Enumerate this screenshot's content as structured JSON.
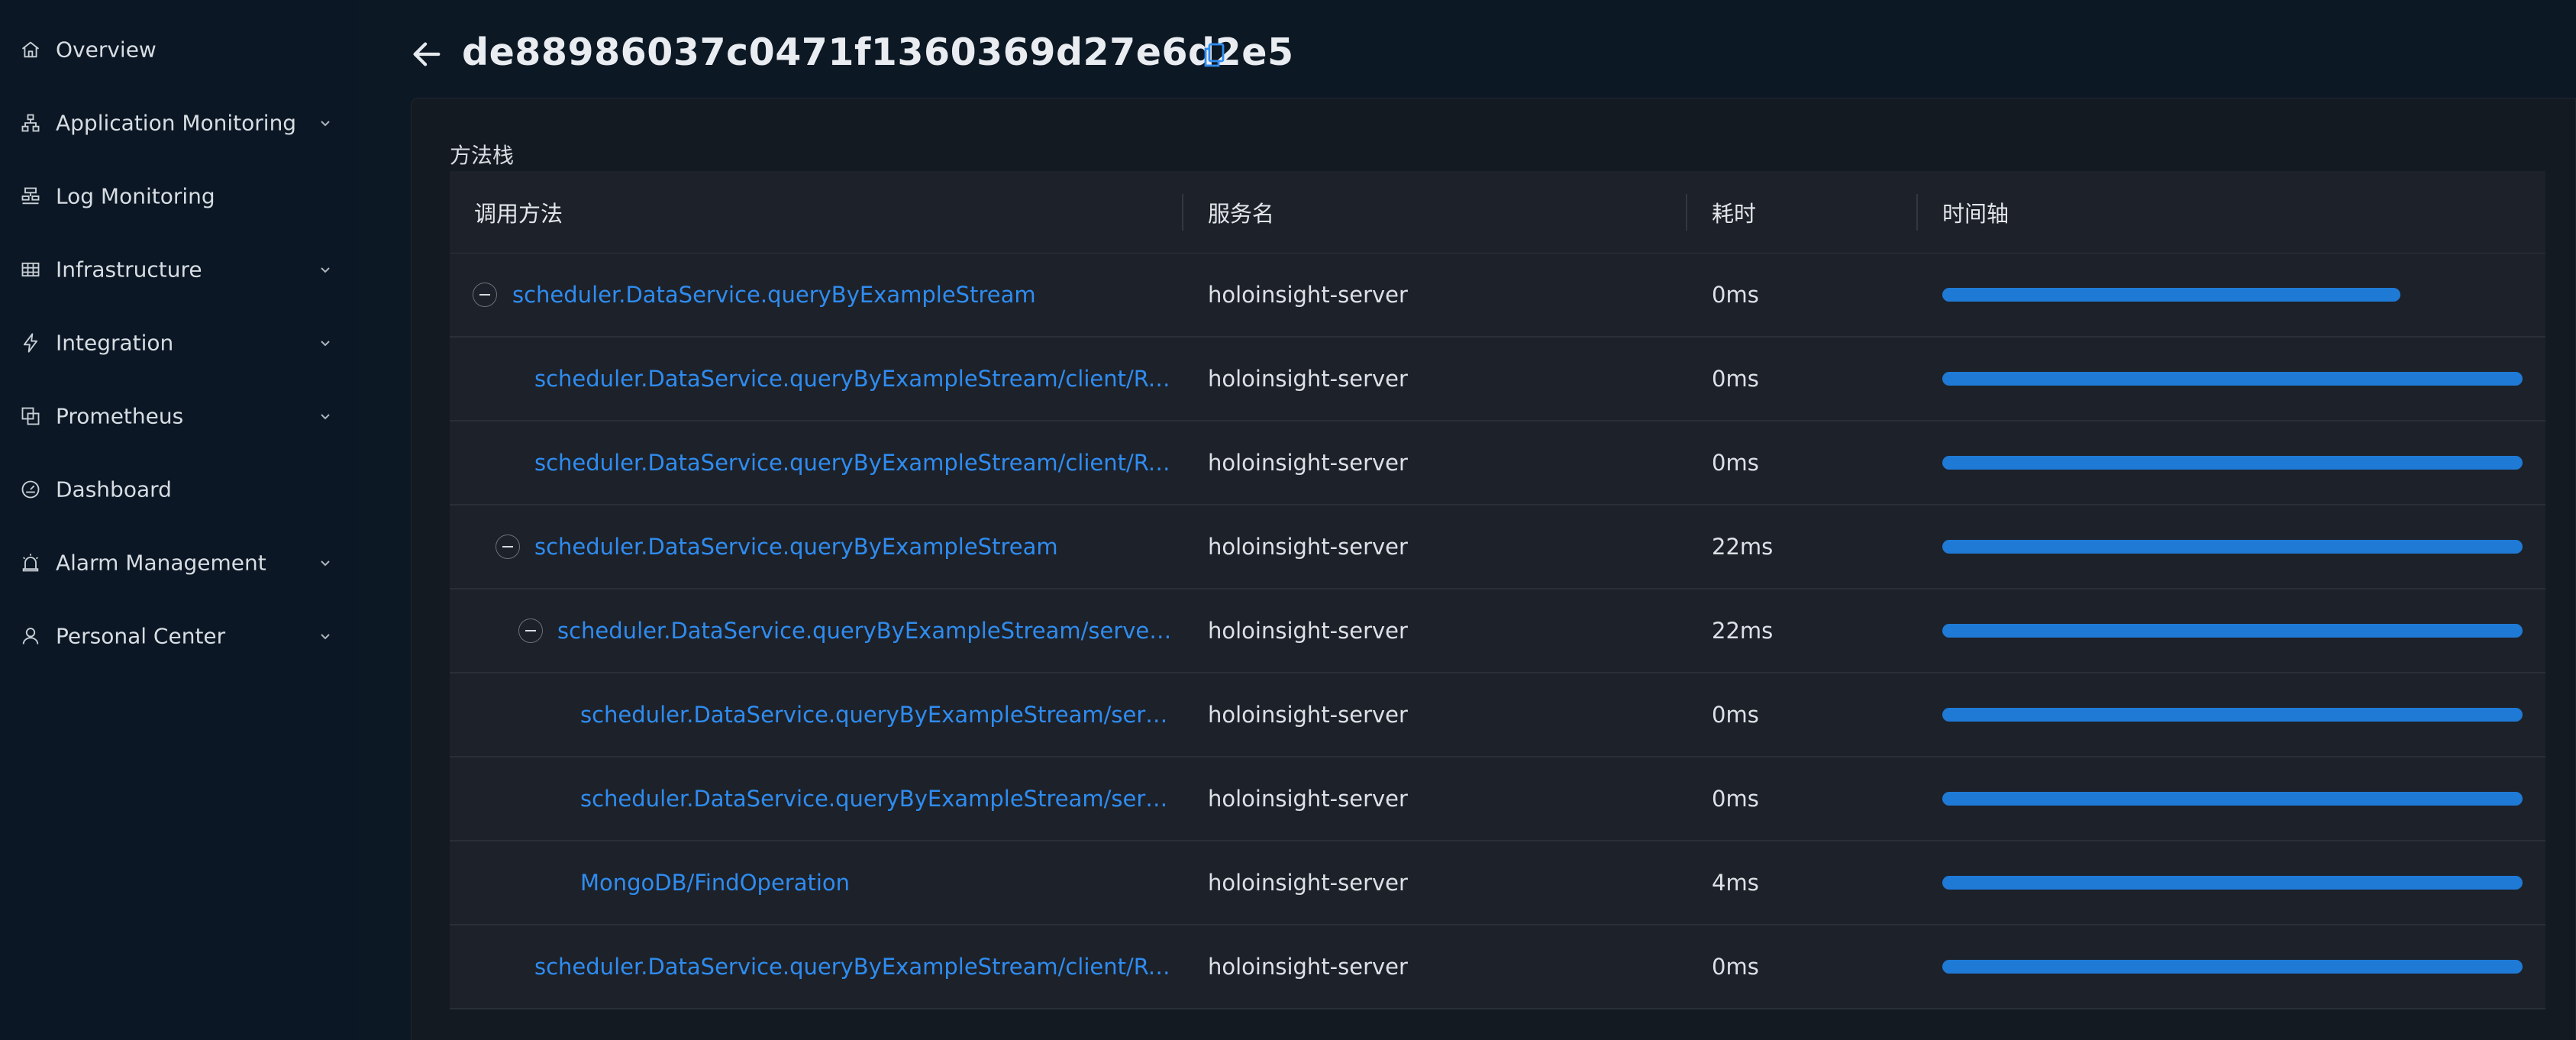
{
  "sidebar": {
    "items": [
      {
        "label": "Overview",
        "icon": "home-icon",
        "expandable": false
      },
      {
        "label": "Application Monitoring",
        "icon": "hierarchy-icon",
        "expandable": true
      },
      {
        "label": "Log Monitoring",
        "icon": "log-tree-icon",
        "expandable": false
      },
      {
        "label": "Infrastructure",
        "icon": "table-grid-icon",
        "expandable": true
      },
      {
        "label": "Integration",
        "icon": "lightning-icon",
        "expandable": true
      },
      {
        "label": "Prometheus",
        "icon": "overlap-squares-icon",
        "expandable": true
      },
      {
        "label": "Dashboard",
        "icon": "gauge-icon",
        "expandable": false
      },
      {
        "label": "Alarm Management",
        "icon": "alarm-icon",
        "expandable": true
      },
      {
        "label": "Personal Center",
        "icon": "user-icon",
        "expandable": true
      }
    ]
  },
  "header": {
    "trace_id": "de88986037c0471f1360369d27e6d2e5",
    "back_icon": "arrow-left-icon",
    "copy_icon": "copy-icon"
  },
  "panel": {
    "section_label": "方法栈",
    "columns": [
      "调用方法",
      "服务名",
      "耗时",
      "时间轴"
    ],
    "rows": [
      {
        "method": "scheduler.DataService.queryByExampleStream",
        "service": "holoinsight-server",
        "duration": "0ms",
        "depth": 0,
        "expandable": true,
        "timeline_fraction": 0.79
      },
      {
        "method": "scheduler.DataService.queryByExampleStream/client/Reques...",
        "service": "holoinsight-server",
        "duration": "0ms",
        "depth": 1,
        "expandable": false,
        "timeline_fraction": 1.0
      },
      {
        "method": "scheduler.DataService.queryByExampleStream/client/Respon...",
        "service": "holoinsight-server",
        "duration": "0ms",
        "depth": 1,
        "expandable": false,
        "timeline_fraction": 1.0
      },
      {
        "method": "scheduler.DataService.queryByExampleStream",
        "service": "holoinsight-server",
        "duration": "22ms",
        "depth": 1,
        "expandable": true,
        "timeline_fraction": 1.0
      },
      {
        "method": "scheduler.DataService.queryByExampleStream/server/Req...",
        "service": "holoinsight-server",
        "duration": "22ms",
        "depth": 2,
        "expandable": true,
        "timeline_fraction": 1.0
      },
      {
        "method": "scheduler.DataService.queryByExampleStream/server/R...",
        "service": "holoinsight-server",
        "duration": "0ms",
        "depth": 3,
        "expandable": false,
        "timeline_fraction": 1.0
      },
      {
        "method": "scheduler.DataService.queryByExampleStream/server/R...",
        "service": "holoinsight-server",
        "duration": "0ms",
        "depth": 3,
        "expandable": false,
        "timeline_fraction": 1.0
      },
      {
        "method": "MongoDB/FindOperation",
        "service": "holoinsight-server",
        "duration": "4ms",
        "depth": 3,
        "expandable": false,
        "timeline_fraction": 1.0
      },
      {
        "method": "scheduler.DataService.queryByExampleStream/client/Respon...",
        "service": "holoinsight-server",
        "duration": "0ms",
        "depth": 1,
        "expandable": false,
        "timeline_fraction": 1.0
      }
    ]
  },
  "colors": {
    "link": "#2f8cf0",
    "timeline_bar": "#1f7ad6",
    "copy_icon": "#2f8cf0"
  }
}
